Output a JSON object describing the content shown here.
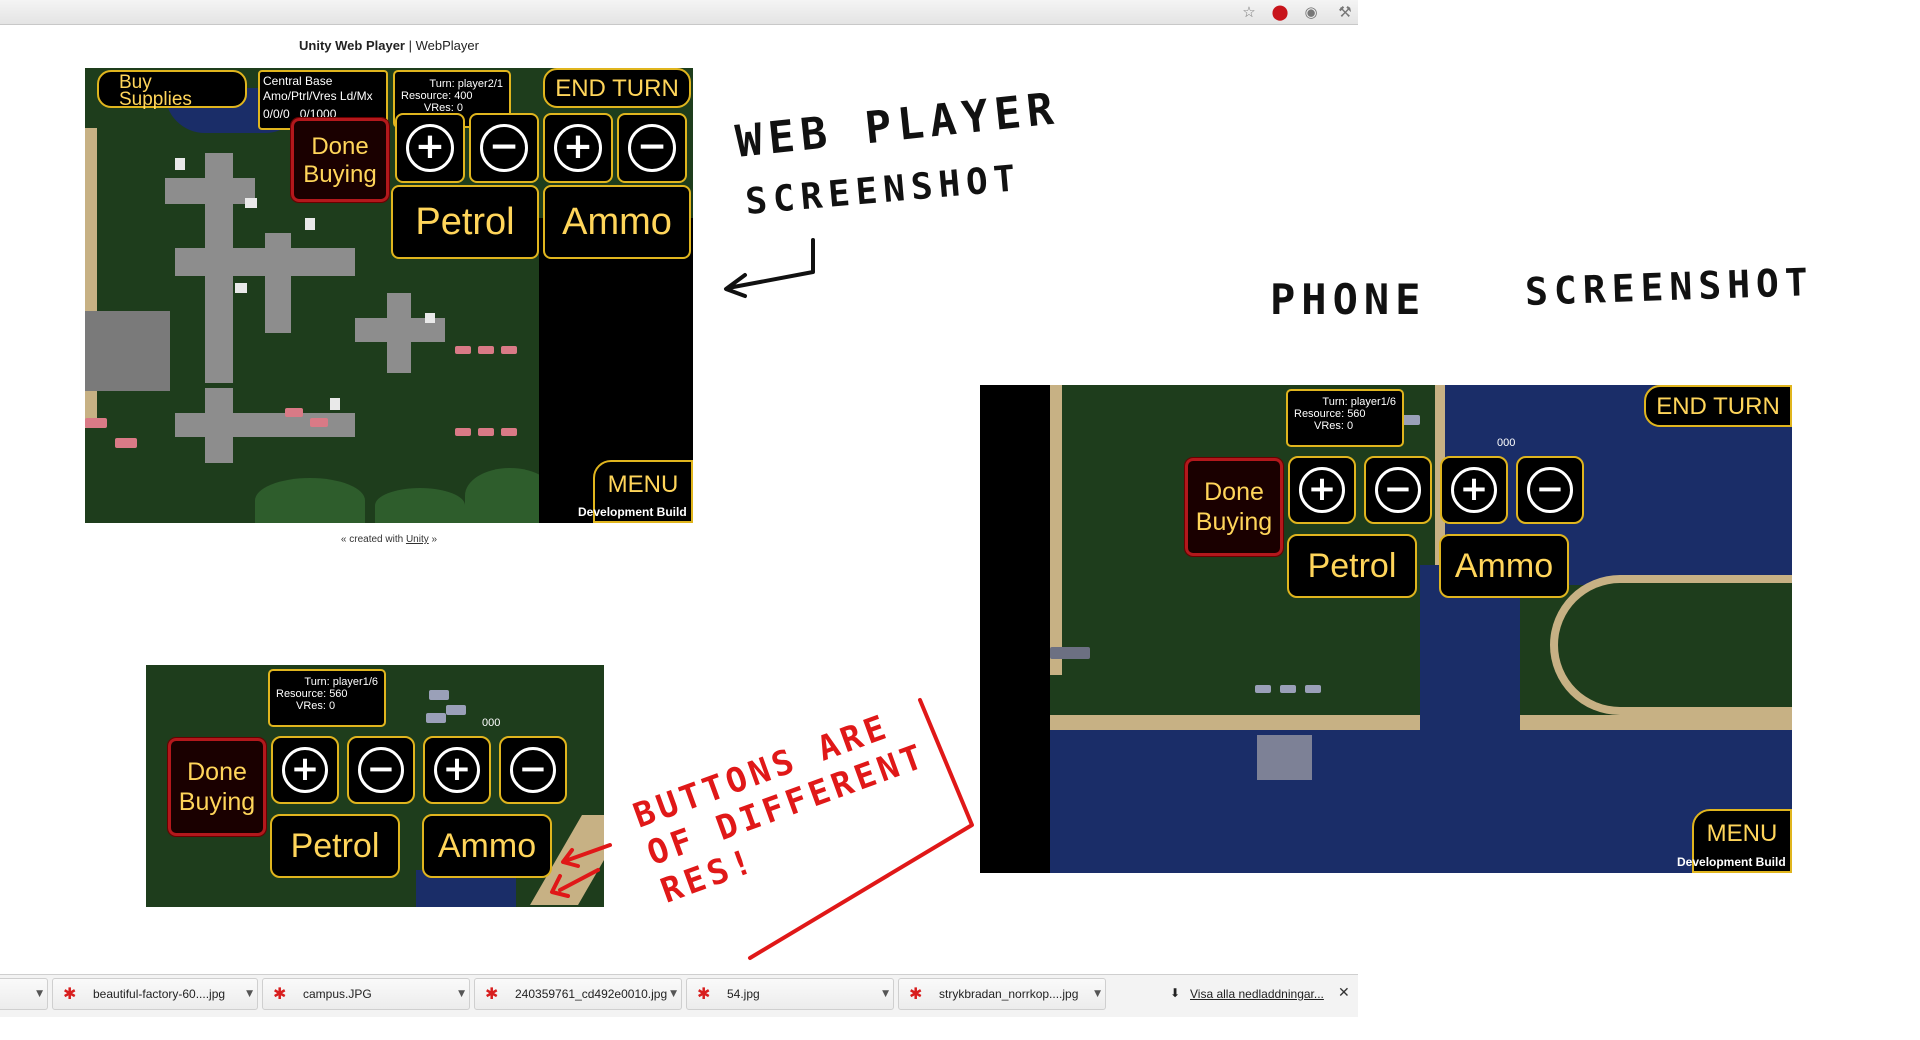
{
  "browser": {
    "icons": [
      "star-icon",
      "opera-icon",
      "eye-icon",
      "wrench-icon"
    ],
    "page_title_bold": "Unity Web Player",
    "page_title_sep": " | ",
    "page_title_rest": "WebPlayer",
    "credit_prefix": "« created with ",
    "credit_link": "Unity",
    "credit_suffix": " »"
  },
  "webplayer": {
    "buy_supplies": "Buy\nSupplies",
    "base_name": "Central Base",
    "base_header": "Amo/Ptrl/Vres Ld/Mx",
    "base_values": "0/0/0   0/1000",
    "turn": "Turn: player2/1",
    "resource": "Resource: 400",
    "vres": "VRes: 0",
    "done_buying": "Done\nBuying",
    "plus": "+",
    "minus": "−",
    "petrol": "Petrol",
    "ammo": "Ammo",
    "end_turn": "END TURN",
    "menu": "MENU",
    "dev_build": "Development Build"
  },
  "small_view": {
    "turn": "Turn: player1/6",
    "resource": "Resource: 560",
    "vres": "VRes: 0",
    "counter": "000",
    "done_buying": "Done\nBuying",
    "plus": "+",
    "minus": "−",
    "petrol": "Petrol",
    "ammo": "Ammo"
  },
  "phone": {
    "turn": "Turn: player1/6",
    "resource": "Resource: 560",
    "vres": "VRes: 0",
    "counter": "000",
    "done_buying": "Done\nBuying",
    "plus": "+",
    "minus": "−",
    "petrol": "Petrol",
    "ammo": "Ammo",
    "end_turn": "END TURN",
    "menu": "MENU",
    "dev_build": "Development Build"
  },
  "annotations": {
    "web_player_1": "WEB PLAYER",
    "web_player_2": "SCREENSHOT",
    "phone_1": "PHONE",
    "phone_2": "SCREENSHOT",
    "buttons_note": "BUTTONS ARE\nOF DIFFERENT\nRES!"
  },
  "downloads": {
    "items": [
      {
        "name": ""
      },
      {
        "name": "beautiful-factory-60....jpg"
      },
      {
        "name": "campus.JPG"
      },
      {
        "name": "240359761_cd492e0010.jpg"
      },
      {
        "name": "54.jpg"
      },
      {
        "name": "strykbradan_norrkop....jpg"
      }
    ],
    "show_all": "Visa alla nedladdningar...",
    "close": "✕"
  },
  "colors": {
    "accent_gold": "#e0b51e",
    "button_text": "#ffd55a",
    "done_border": "#b3181c",
    "annotation_red": "#e01818"
  }
}
